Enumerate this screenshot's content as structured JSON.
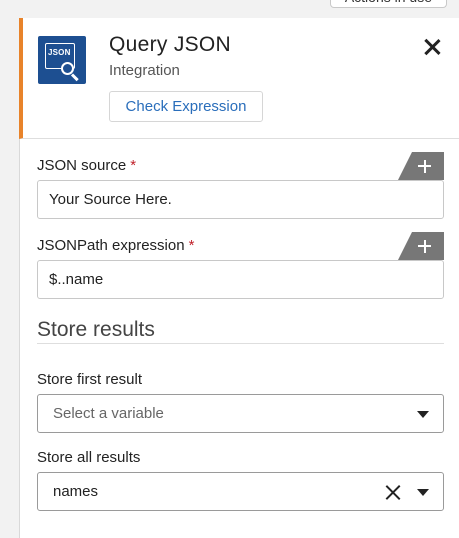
{
  "topbar": {
    "actions_label": "Actions in use"
  },
  "panel": {
    "icon_text": "JSON",
    "title": "Query JSON",
    "subtitle": "Integration",
    "check_button_label": "Check Expression",
    "accent_color": "#e8832a",
    "icon_color": "#1d4f91"
  },
  "fields": {
    "json_source": {
      "label": "JSON source",
      "required_mark": "*",
      "value": "Your Source Here."
    },
    "jsonpath": {
      "label": "JSONPath expression",
      "required_mark": "*",
      "value": "$..name"
    }
  },
  "store_results": {
    "section_title": "Store results",
    "first": {
      "label": "Store first result",
      "placeholder": "Select a variable"
    },
    "all": {
      "label": "Store all results",
      "value": "names"
    }
  },
  "icons": {
    "close": "close-icon",
    "add": "plus-icon",
    "dropdown": "caret-down-icon",
    "clear": "clear-icon"
  }
}
